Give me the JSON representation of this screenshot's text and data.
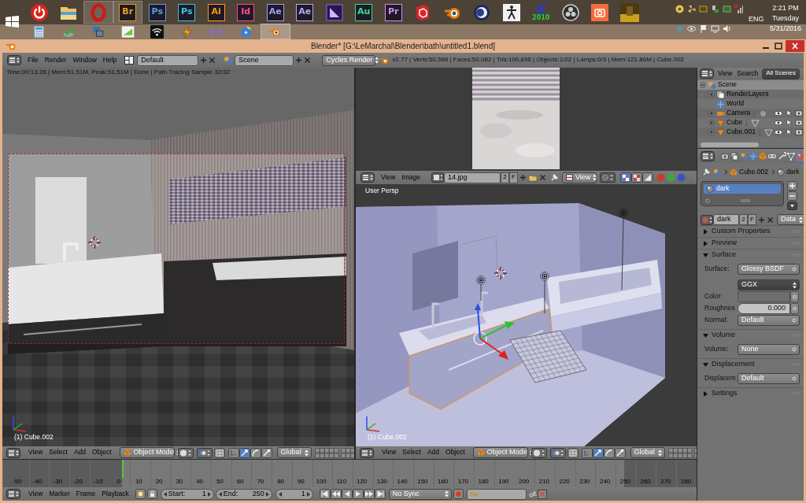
{
  "taskbar": {
    "apps": [
      {
        "kind": "glyph",
        "active": false
      },
      {
        "kind": "glyph",
        "active": false
      },
      {
        "kind": "glyph",
        "active": true
      },
      {
        "kind": "tile",
        "label": "Br",
        "color": "#e8a01e",
        "active": true
      },
      {
        "kind": "tile",
        "label": "Ps",
        "color": "#5b9bf0",
        "active": false
      },
      {
        "kind": "tile",
        "label": "Ps",
        "color": "#3ec3e6",
        "active": false
      },
      {
        "kind": "tile",
        "label": "Ai",
        "color": "#ff9a1a",
        "active": false
      },
      {
        "kind": "tile",
        "label": "Id",
        "color": "#ff4a8d",
        "active": false
      },
      {
        "kind": "tile",
        "label": "Ae",
        "color": "#a49bff",
        "active": false
      },
      {
        "kind": "tile",
        "label": "Ae",
        "color": "#b3a6ff",
        "active": false
      },
      {
        "kind": "glyph",
        "active": false
      },
      {
        "kind": "tile",
        "label": "Au",
        "color": "#3fd6a3",
        "active": false
      },
      {
        "kind": "tile",
        "label": "Pr",
        "color": "#d58cff",
        "active": false
      },
      {
        "kind": "glyph",
        "active": false
      },
      {
        "kind": "glyph",
        "active": false
      },
      {
        "kind": "glyph",
        "active": false
      },
      {
        "kind": "glyph",
        "active": false
      },
      {
        "kind": "logo",
        "label": "K",
        "sublabel": "2010",
        "active": false
      },
      {
        "kind": "glyph",
        "active": false
      },
      {
        "kind": "glyph",
        "active": false
      },
      {
        "kind": "glyph",
        "active": false
      }
    ],
    "apps_row2": [
      {
        "kind": "glyph",
        "active": false
      },
      {
        "kind": "glyph",
        "active": false
      },
      {
        "kind": "glyph",
        "active": false
      },
      {
        "kind": "glyph",
        "active": false
      },
      {
        "kind": "glyph",
        "active": false
      },
      {
        "kind": "glyph",
        "active": false
      },
      {
        "kind": "glyph",
        "active": false
      },
      {
        "kind": "glyph",
        "active": false
      },
      {
        "kind": "glyph",
        "active": true
      }
    ],
    "language": "ENG",
    "time": "2:21 PM",
    "weekday": "Tuesday",
    "date": "5/31/2016"
  },
  "window": {
    "title": "Blender* [G:\\LeMarchal\\Blender\\bath\\untitled1.blend]"
  },
  "info_header": {
    "menus": [
      "File",
      "Render",
      "Window",
      "Help"
    ],
    "layout": "Default",
    "scene": "Scene",
    "engine": "Cycles Render",
    "stats": "v2.77 | Verts:50,566 | Faces:50,082 | Tris:100,696 | Objects:1/22 | Lamps:0/3 | Mem:121.86M | Cube.002"
  },
  "render_view": {
    "info": "Time:00:13.26 | Mem:51.51M, Peak:51.51M | Done | Path Tracing Sample 32/32",
    "object": "(1) Cube.002"
  },
  "image_header": {
    "menus": [
      "View",
      "Image"
    ],
    "image": "14.jpg",
    "users": "2",
    "fake_user": "F",
    "view": "View",
    "channels": [
      {
        "selected": true
      },
      {
        "selected": false
      },
      {
        "selected": false
      }
    ],
    "channel_dots": [
      {
        "color": "#c83a30"
      },
      {
        "color": "#3aa83a"
      },
      {
        "color": "#3a52c0"
      }
    ]
  },
  "view3d": {
    "label": "User Persp",
    "object": "(1) Cube.002"
  },
  "view3d_headers": [
    {
      "menus": [
        "View",
        "Select",
        "Add",
        "Object"
      ],
      "mode": "Object Mode",
      "manipulators": [
        {
          "selected": false
        },
        {
          "selected": true
        },
        {
          "selected": false
        },
        {
          "selected": false
        }
      ],
      "orientation": "Global"
    },
    {
      "menus": [
        "View",
        "Select",
        "Add",
        "Object"
      ],
      "mode": "Object Mode",
      "manipulators": [
        {
          "selected": false
        },
        {
          "selected": true
        },
        {
          "selected": false
        },
        {
          "selected": false
        }
      ],
      "orientation": "Global"
    }
  ],
  "timeline": {
    "ruler": [
      "-50",
      "-40",
      "-30",
      "-20",
      "-10",
      "0",
      "10",
      "20",
      "30",
      "40",
      "50",
      "60",
      "70",
      "80",
      "90",
      "100",
      "110",
      "120",
      "130",
      "140",
      "150",
      "160",
      "170",
      "180",
      "190",
      "200",
      "210",
      "220",
      "230",
      "240",
      "250",
      "260",
      "270",
      "280"
    ],
    "playhead": {
      "level": 0.172
    }
  },
  "timeline_header": {
    "menus": [
      "View",
      "Marker",
      "Frame",
      "Playback"
    ],
    "start_label": "Start:",
    "start": "1",
    "end_label": "End:",
    "end": "250",
    "frame": "1",
    "sync": "No Sync"
  },
  "outliner": {
    "menus": [
      "View",
      "Search"
    ],
    "display": "All Scenes",
    "tree": [
      {
        "label": "Scene",
        "kind": "scene",
        "selected": true,
        "expanded": true,
        "children": [
          {
            "label": "RenderLayers",
            "kind": "renderlayers",
            "selected": false,
            "expanded": false
          },
          {
            "label": "World",
            "kind": "world",
            "selected": false
          },
          {
            "label": "Camera",
            "kind": "camera",
            "selected": false,
            "expanded": false
          },
          {
            "label": "Cube",
            "kind": "mesh",
            "selected": false,
            "expanded": false
          },
          {
            "label": "Cube.001",
            "kind": "mesh",
            "selected": false,
            "expanded": false
          }
        ]
      }
    ]
  },
  "properties": {
    "tabs": [
      {
        "selected": false
      },
      {
        "selected": false
      },
      {
        "selected": false
      },
      {
        "selected": false
      },
      {
        "selected": false
      },
      {
        "selected": false
      },
      {
        "selected": false
      },
      {
        "selected": false
      },
      {
        "selected": true
      }
    ],
    "breadcrumb": [
      {
        "label": "Cube.002",
        "kind": "object"
      },
      {
        "label": "dark",
        "kind": "material"
      }
    ],
    "material_slots": [
      {
        "label": "dark",
        "selected": true
      }
    ],
    "material": {
      "name": "dark",
      "users": "2",
      "fake_user": "F",
      "link": "Data"
    },
    "panels": [
      {
        "title": "Custom Properties",
        "expanded": false
      },
      {
        "title": "Preview",
        "expanded": false
      },
      {
        "title": "Surface",
        "expanded": true,
        "rows": [
          {
            "kind": "menu",
            "label": "Surface:",
            "value": "Glossy BSDF"
          },
          {
            "kind": "select",
            "value": "GGX"
          },
          {
            "kind": "color",
            "label": "Color:",
            "color": "#6e6e6e"
          },
          {
            "kind": "number",
            "label": "Roughnes",
            "value": "0.000"
          },
          {
            "kind": "menu",
            "label": "Normal:",
            "value": "Default"
          }
        ]
      },
      {
        "title": "Volume",
        "expanded": true,
        "rows": [
          {
            "kind": "menu",
            "label": "Volume:",
            "value": "None"
          }
        ]
      },
      {
        "title": "Displacement",
        "expanded": true,
        "rows": [
          {
            "kind": "menu",
            "label": "Displacem",
            "value": "Default"
          }
        ]
      },
      {
        "title": "Settings",
        "expanded": false
      }
    ]
  }
}
